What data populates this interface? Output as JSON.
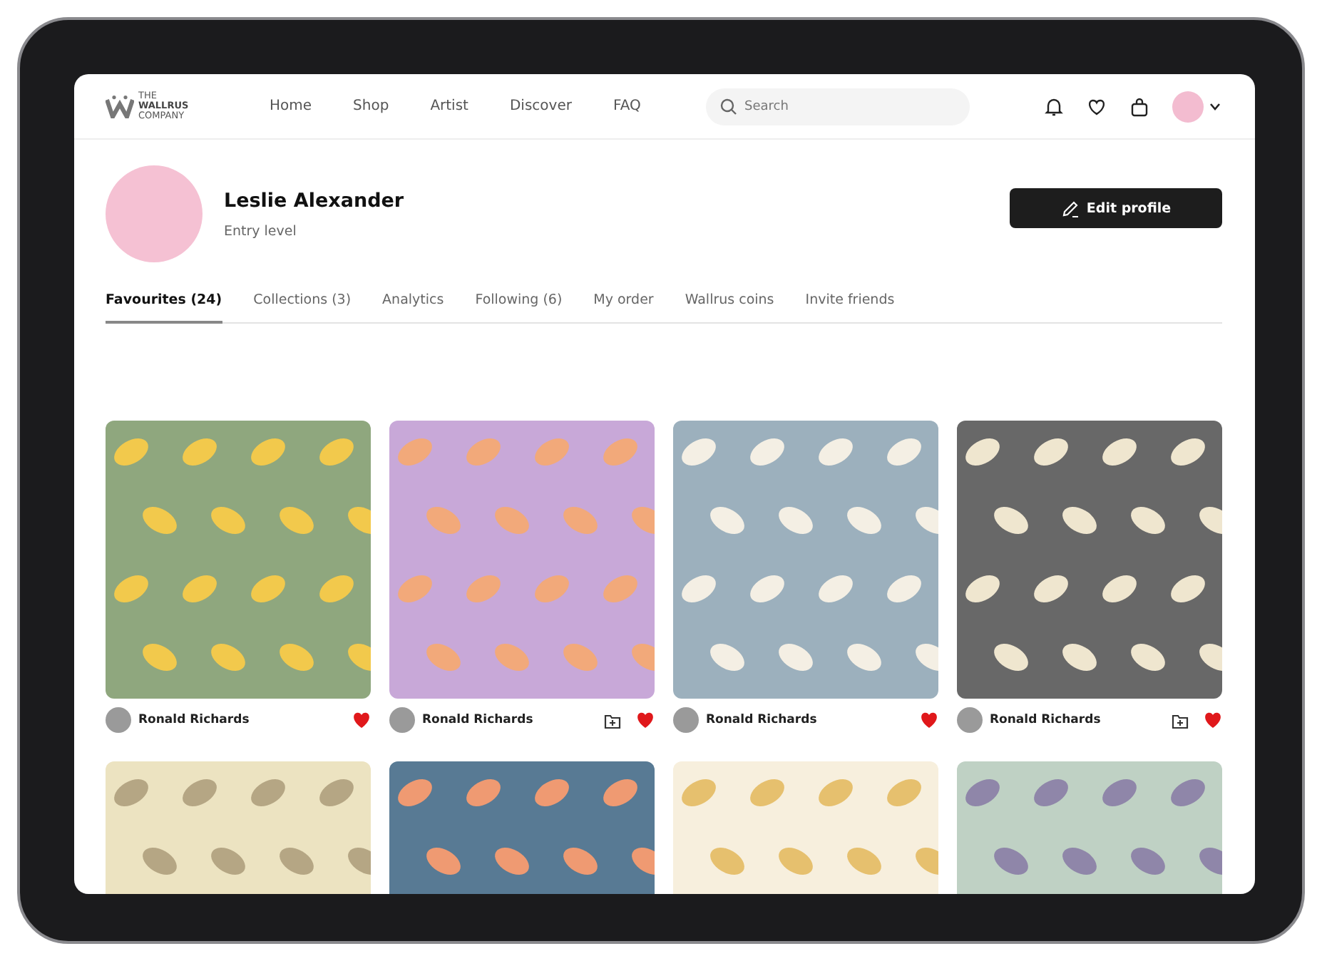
{
  "header": {
    "logo": {
      "line_1": "THE",
      "line_2": "WALLRUS",
      "line_3": "COMPANY"
    },
    "nav": [
      "Home",
      "Shop",
      "Artist",
      "Discover",
      "FAQ"
    ],
    "search": {
      "placeholder": "Search"
    }
  },
  "profile": {
    "name": "Leslie Alexander",
    "level": "Entry level",
    "edit_button": "Edit profile"
  },
  "tabs": [
    {
      "label": "Favourites (24)",
      "selected": true
    },
    {
      "label": "Collections (3)",
      "selected": false
    },
    {
      "label": "Analytics",
      "selected": false
    },
    {
      "label": "Following (6)",
      "selected": false
    },
    {
      "label": "My order",
      "selected": false
    },
    {
      "label": "Wallrus coins",
      "selected": false
    },
    {
      "label": "Invite friends",
      "selected": false
    }
  ],
  "cards": [
    {
      "kind": "leaf",
      "artist": "Ronald Richards",
      "add_button": false,
      "liked": true
    },
    {
      "kind": "geometric",
      "artist": "Ronald Richards",
      "add_button": true,
      "liked": true
    },
    {
      "kind": "floral",
      "artist": "Ronald Richards",
      "add_button": false,
      "liked": true
    },
    {
      "kind": "leaf-dark",
      "artist": "Ronald Richards",
      "add_button": true,
      "liked": true
    },
    {
      "kind": "lattice"
    },
    {
      "kind": "leaf-blue"
    },
    {
      "kind": "squares"
    },
    {
      "kind": "floral-green"
    }
  ]
}
